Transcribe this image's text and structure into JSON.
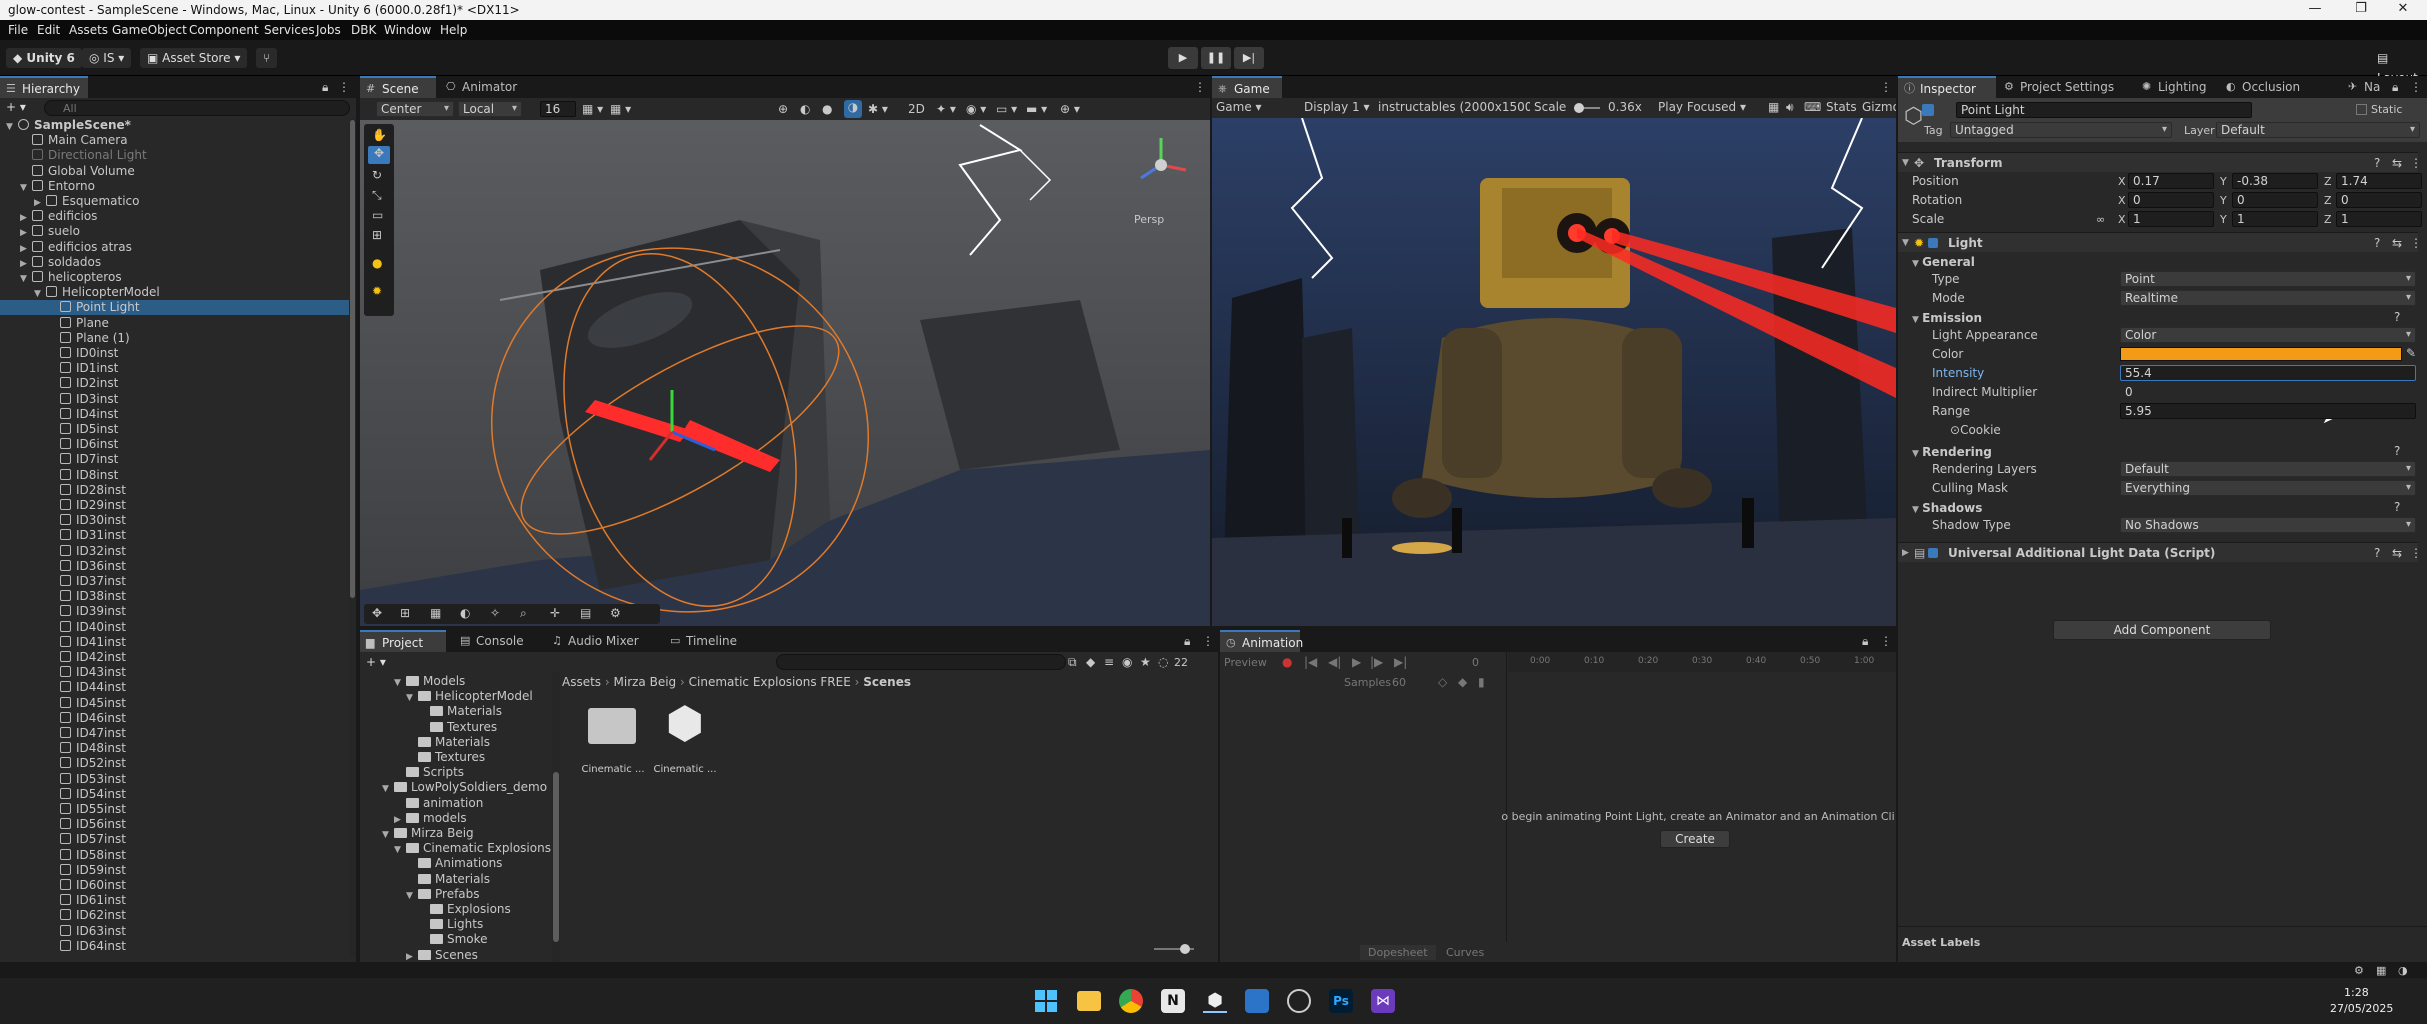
{
  "window": {
    "title": "glow-contest - SampleScene - Windows, Mac, Linux - Unity 6 (6000.0.28f1)* <DX11>"
  },
  "menu": [
    "File",
    "Edit",
    "Assets",
    "GameObject",
    "Component",
    "Services",
    "Jobs",
    "DBK",
    "Window",
    "Help"
  ],
  "toolbar": {
    "unity": "Unity 6",
    "account": "IS",
    "asset_store": "Asset Store",
    "layout": "Layout"
  },
  "hierarchy": {
    "tab": "Hierarchy",
    "search_placeholder": "All",
    "rows": [
      {
        "label": "SampleScene*",
        "depth": 0,
        "arrow": "▼",
        "kind": "scene"
      },
      {
        "label": "Main Camera",
        "depth": 1,
        "arrow": ""
      },
      {
        "label": "Directional Light",
        "depth": 1,
        "arrow": "",
        "dim": true
      },
      {
        "label": "Global Volume",
        "depth": 1,
        "arrow": ""
      },
      {
        "label": "Entorno",
        "depth": 1,
        "arrow": "▼"
      },
      {
        "label": "Esquematico",
        "depth": 2,
        "arrow": "▶"
      },
      {
        "label": "edificios",
        "depth": 1,
        "arrow": "▶"
      },
      {
        "label": "suelo",
        "depth": 1,
        "arrow": "▶"
      },
      {
        "label": "edificios atras",
        "depth": 1,
        "arrow": "▶"
      },
      {
        "label": "soldados",
        "depth": 1,
        "arrow": "▶"
      },
      {
        "label": "helicopteros",
        "depth": 1,
        "arrow": "▼"
      },
      {
        "label": "HelicopterModel",
        "depth": 2,
        "arrow": "▼"
      },
      {
        "label": "Point Light",
        "depth": 3,
        "arrow": "",
        "selected": true
      },
      {
        "label": "Plane",
        "depth": 3,
        "arrow": ""
      },
      {
        "label": "Plane (1)",
        "depth": 3,
        "arrow": ""
      },
      {
        "label": "ID0inst",
        "depth": 3,
        "arrow": ""
      },
      {
        "label": "ID1inst",
        "depth": 3,
        "arrow": ""
      },
      {
        "label": "ID2inst",
        "depth": 3,
        "arrow": ""
      },
      {
        "label": "ID3inst",
        "depth": 3,
        "arrow": ""
      },
      {
        "label": "ID4inst",
        "depth": 3,
        "arrow": ""
      },
      {
        "label": "ID5inst",
        "depth": 3,
        "arrow": ""
      },
      {
        "label": "ID6inst",
        "depth": 3,
        "arrow": ""
      },
      {
        "label": "ID7inst",
        "depth": 3,
        "arrow": ""
      },
      {
        "label": "ID8inst",
        "depth": 3,
        "arrow": ""
      },
      {
        "label": "ID28inst",
        "depth": 3,
        "arrow": ""
      },
      {
        "label": "ID29inst",
        "depth": 3,
        "arrow": ""
      },
      {
        "label": "ID30inst",
        "depth": 3,
        "arrow": ""
      },
      {
        "label": "ID31inst",
        "depth": 3,
        "arrow": ""
      },
      {
        "label": "ID32inst",
        "depth": 3,
        "arrow": ""
      },
      {
        "label": "ID36inst",
        "depth": 3,
        "arrow": ""
      },
      {
        "label": "ID37inst",
        "depth": 3,
        "arrow": ""
      },
      {
        "label": "ID38inst",
        "depth": 3,
        "arrow": ""
      },
      {
        "label": "ID39inst",
        "depth": 3,
        "arrow": ""
      },
      {
        "label": "ID40inst",
        "depth": 3,
        "arrow": ""
      },
      {
        "label": "ID41inst",
        "depth": 3,
        "arrow": ""
      },
      {
        "label": "ID42inst",
        "depth": 3,
        "arrow": ""
      },
      {
        "label": "ID43inst",
        "depth": 3,
        "arrow": ""
      },
      {
        "label": "ID44inst",
        "depth": 3,
        "arrow": ""
      },
      {
        "label": "ID45inst",
        "depth": 3,
        "arrow": ""
      },
      {
        "label": "ID46inst",
        "depth": 3,
        "arrow": ""
      },
      {
        "label": "ID47inst",
        "depth": 3,
        "arrow": ""
      },
      {
        "label": "ID48inst",
        "depth": 3,
        "arrow": ""
      },
      {
        "label": "ID52inst",
        "depth": 3,
        "arrow": ""
      },
      {
        "label": "ID53inst",
        "depth": 3,
        "arrow": ""
      },
      {
        "label": "ID54inst",
        "depth": 3,
        "arrow": ""
      },
      {
        "label": "ID55inst",
        "depth": 3,
        "arrow": ""
      },
      {
        "label": "ID56inst",
        "depth": 3,
        "arrow": ""
      },
      {
        "label": "ID57inst",
        "depth": 3,
        "arrow": ""
      },
      {
        "label": "ID58inst",
        "depth": 3,
        "arrow": ""
      },
      {
        "label": "ID59inst",
        "depth": 3,
        "arrow": ""
      },
      {
        "label": "ID60inst",
        "depth": 3,
        "arrow": ""
      },
      {
        "label": "ID61inst",
        "depth": 3,
        "arrow": ""
      },
      {
        "label": "ID62inst",
        "depth": 3,
        "arrow": ""
      },
      {
        "label": "ID63inst",
        "depth": 3,
        "arrow": ""
      },
      {
        "label": "ID64inst",
        "depth": 3,
        "arrow": ""
      }
    ]
  },
  "scene": {
    "tabs": [
      "Scene",
      "Animator"
    ],
    "pivot": "Center",
    "space": "Local",
    "snap": "16",
    "persp": "Persp"
  },
  "game": {
    "tab": "Game",
    "mode": "Game",
    "display": "Display 1",
    "resolution": "instructables (2000x1500)",
    "scale_label": "Scale",
    "scale": "0.36x",
    "play_mode": "Play Focused",
    "stats": "Stats",
    "gizmos": "Gizmos"
  },
  "project": {
    "tabs": [
      "Project",
      "Console",
      "Audio Mixer",
      "Timeline"
    ],
    "count": "22",
    "breadcrumb": [
      "Assets",
      "Mirza Beig",
      "Cinematic Explosions FREE",
      "Scenes"
    ],
    "tree": [
      {
        "label": "Models",
        "depth": 2,
        "arrow": "▼"
      },
      {
        "label": "HelicopterModel",
        "depth": 3,
        "arrow": "▼"
      },
      {
        "label": "Materials",
        "depth": 4,
        "arrow": ""
      },
      {
        "label": "Textures",
        "depth": 4,
        "arrow": ""
      },
      {
        "label": "Materials",
        "depth": 3,
        "arrow": ""
      },
      {
        "label": "Textures",
        "depth": 3,
        "arrow": ""
      },
      {
        "label": "Scripts",
        "depth": 2,
        "arrow": ""
      },
      {
        "label": "LowPolySoldiers_demo",
        "depth": 1,
        "arrow": "▼"
      },
      {
        "label": "animation",
        "depth": 2,
        "arrow": ""
      },
      {
        "label": "models",
        "depth": 2,
        "arrow": "▶"
      },
      {
        "label": "Mirza Beig",
        "depth": 1,
        "arrow": "▼"
      },
      {
        "label": "Cinematic Explosions FI",
        "depth": 2,
        "arrow": "▼"
      },
      {
        "label": "Animations",
        "depth": 3,
        "arrow": ""
      },
      {
        "label": "Materials",
        "depth": 3,
        "arrow": ""
      },
      {
        "label": "Prefabs",
        "depth": 3,
        "arrow": "▼"
      },
      {
        "label": "Explosions",
        "depth": 4,
        "arrow": ""
      },
      {
        "label": "Lights",
        "depth": 4,
        "arrow": ""
      },
      {
        "label": "Smoke",
        "depth": 4,
        "arrow": ""
      },
      {
        "label": "Scenes",
        "depth": 3,
        "arrow": "▶"
      }
    ],
    "assets": [
      {
        "label": "Cinematic ...",
        "kind": "folder"
      },
      {
        "label": "Cinematic ...",
        "kind": "unity"
      }
    ]
  },
  "animation": {
    "tab": "Animation",
    "preview": "Preview",
    "frame": "0",
    "samples_label": "Samples",
    "samples": "60",
    "ticks": [
      "0:00",
      "0:10",
      "0:20",
      "0:30",
      "0:40",
      "0:50",
      "1:00"
    ],
    "message": "o begin animating Point Light, create an Animator and an Animation Cli",
    "create": "Create",
    "dopesheet": "Dopesheet",
    "curves": "Curves"
  },
  "inspector": {
    "tabs": [
      "Inspector",
      "Project Settings",
      "Lighting",
      "Occlusion",
      "Na"
    ],
    "object_name": "Point Light",
    "static": "Static",
    "tag_label": "Tag",
    "tag": "Untagged",
    "layer_label": "Layer",
    "layer": "Default",
    "transform": {
      "title": "Transform",
      "position": {
        "label": "Position",
        "x": "0.17",
        "y": "-0.38",
        "z": "1.74"
      },
      "rotation": {
        "label": "Rotation",
        "x": "0",
        "y": "0",
        "z": "0"
      },
      "scale": {
        "label": "Scale",
        "x": "1",
        "y": "1",
        "z": "1"
      }
    },
    "light": {
      "title": "Light",
      "general": "General",
      "type_label": "Type",
      "type": "Point",
      "mode_label": "Mode",
      "mode": "Realtime",
      "emission": "Emission",
      "appearance_label": "Light Appearance",
      "appearance": "Color",
      "color_label": "Color",
      "color": "#f39a17",
      "intensity_label": "Intensity",
      "intensity": "55.4",
      "indirect_label": "Indirect Multiplier",
      "indirect": "0",
      "range_label": "Range",
      "range": "5.95",
      "cookie_label": "Cookie",
      "rendering": "Rendering",
      "layers_label": "Rendering Layers",
      "layers": "Default",
      "culling_label": "Culling Mask",
      "culling": "Everything",
      "shadows": "Shadows",
      "shadow_type_label": "Shadow Type",
      "shadow_type": "No Shadows"
    },
    "urp": "Universal Additional Light Data (Script)",
    "add_component": "Add Component",
    "asset_labels": "Asset Labels"
  },
  "taskbar": {
    "time": "1:28",
    "date": "27/05/2025"
  }
}
